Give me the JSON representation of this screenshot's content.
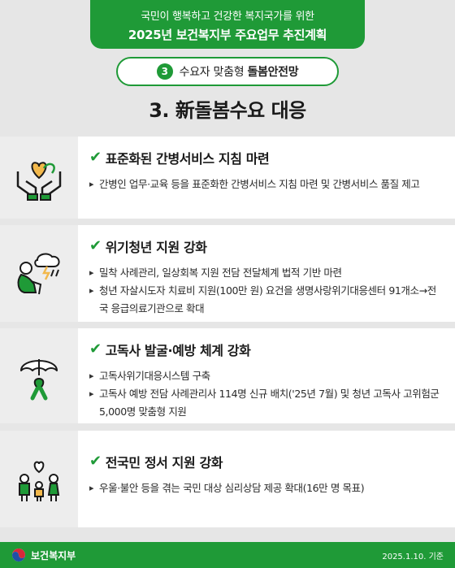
{
  "header": {
    "subtitle": "국민이 행복하고 건강한 복지국가를 위한",
    "title": "2025년 보건복지부 주요업무 추진계획"
  },
  "pill": {
    "number": "3",
    "text": "수요자 맞춤형",
    "strong": "돌봄안전망"
  },
  "main_title": "3. 新돌봄수요 대응",
  "sections": [
    {
      "check": "✔",
      "title": "표준화된 간병서비스 지침 마련",
      "bullets": [
        "간병인 업무·교육 등을 표준화한 간병서비스 지침 마련 및 간병서비스 품질 제고"
      ]
    },
    {
      "check": "✔",
      "title": "위기청년 지원 강화",
      "bullets": [
        "밀착 사례관리, 일상회복 지원 전담 전달체계 법적 기반 마련",
        "청년 자살시도자 치료비 지원(100만 원) 요건을 생명사랑위기대응센터 91개소→전국 응급의료기관으로 확대"
      ]
    },
    {
      "check": "✔",
      "title": "고독사 발굴·예방 체계 강화",
      "bullets": [
        "고독사위기대응시스템 구축",
        "고독사 예방 전담 사례관리사 114명 신규 배치('25년 7월) 및 청년 고독사 고위험군 5,000명 맞춤형 지원"
      ]
    },
    {
      "check": "✔",
      "title": "전국민 정서 지원 강화",
      "bullets": [
        "우울·불안 등을 겪는 국민 대상 심리상담 제공 확대(16만 명 목표)"
      ]
    }
  ],
  "footer": {
    "logo_text": "보건복지부",
    "date": "2025.1.10. 기준"
  },
  "colors": {
    "accent": "#1f9a37",
    "background": "#e6e6e6",
    "icon_panel": "#ededed"
  }
}
